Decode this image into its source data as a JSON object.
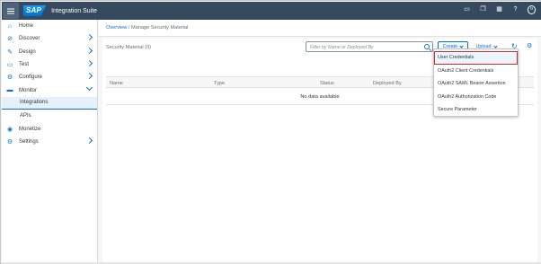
{
  "shell": {
    "logo": "SAP",
    "title": "Integration Suite",
    "icons": [
      "notes-icon",
      "copy-icon",
      "grid-icon",
      "help-icon",
      "user-icon"
    ],
    "avatar_label": "o"
  },
  "sidebar": {
    "items": [
      {
        "label": "Home",
        "icon": "home-icon",
        "glyph": "⌂",
        "chevron": "none"
      },
      {
        "label": "Discover",
        "icon": "compass-icon",
        "glyph": "⊘",
        "chevron": "right"
      },
      {
        "label": "Design",
        "icon": "pencil-icon",
        "glyph": "✎",
        "chevron": "right"
      },
      {
        "label": "Test",
        "icon": "test-icon",
        "glyph": "▭",
        "chevron": "right"
      },
      {
        "label": "Configure",
        "icon": "configure-icon",
        "glyph": "⚙",
        "chevron": "right"
      },
      {
        "label": "Monitor",
        "icon": "monitor-icon",
        "glyph": "▬",
        "chevron": "down"
      },
      {
        "label": "Integrations",
        "sub": true,
        "selected": true
      },
      {
        "label": "APIs",
        "sub": true
      },
      {
        "label": "Monetize",
        "icon": "monetize-icon",
        "glyph": "◉",
        "chevron": "none"
      },
      {
        "label": "Settings",
        "icon": "settings-icon",
        "glyph": "⚙",
        "chevron": "right"
      }
    ]
  },
  "breadcrumb": {
    "link": "Overview",
    "separator": " / ",
    "current": "Manage Security Material"
  },
  "toolbar": {
    "title": "Security Material (0)",
    "search_placeholder": "Filter by Name or Deployed By",
    "create_label": "Create",
    "upload_label": "Upload"
  },
  "table": {
    "columns": [
      "Name",
      "Type",
      "Status",
      "Deployed By"
    ],
    "empty_text": "No data available"
  },
  "dropdown": {
    "items": [
      "User Credentials",
      "OAuth2 Client Credentials",
      "OAuth2 SAML Bearer Assertion",
      "OAuth2 Authorization Code",
      "Secure Parameter"
    ],
    "highlighted_index": 0
  },
  "colors": {
    "shell": "#354a5f",
    "accent": "#0a6ed1",
    "highlight_border": "#d7262c"
  }
}
